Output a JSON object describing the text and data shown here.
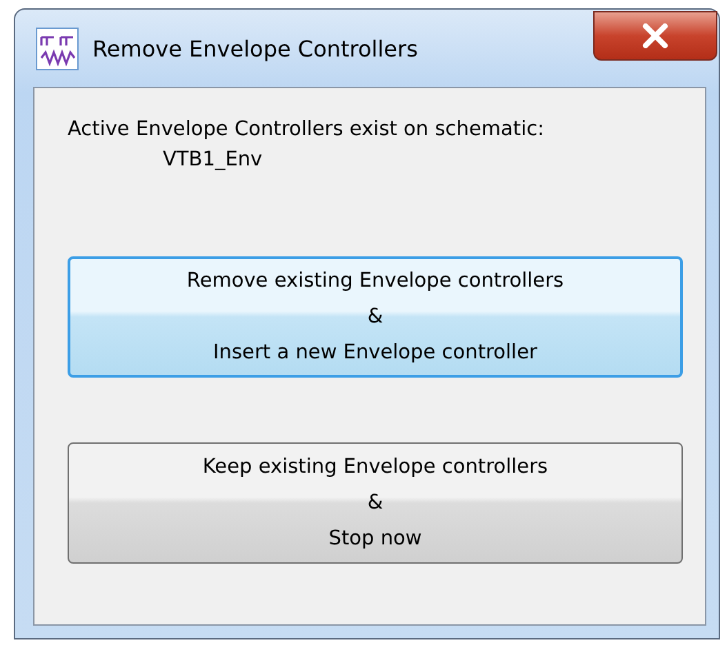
{
  "window": {
    "title": "Remove Envelope Controllers"
  },
  "message": "Active Envelope Controllers exist on schematic:",
  "schematic_item": "VTB1_Env",
  "buttons": [
    {
      "lines": [
        "Remove existing Envelope controllers",
        "&",
        "Insert a new Envelope controller"
      ],
      "highlighted": true
    },
    {
      "lines": [
        "Keep existing Envelope controllers",
        "&",
        "Stop now"
      ],
      "highlighted": false
    }
  ]
}
